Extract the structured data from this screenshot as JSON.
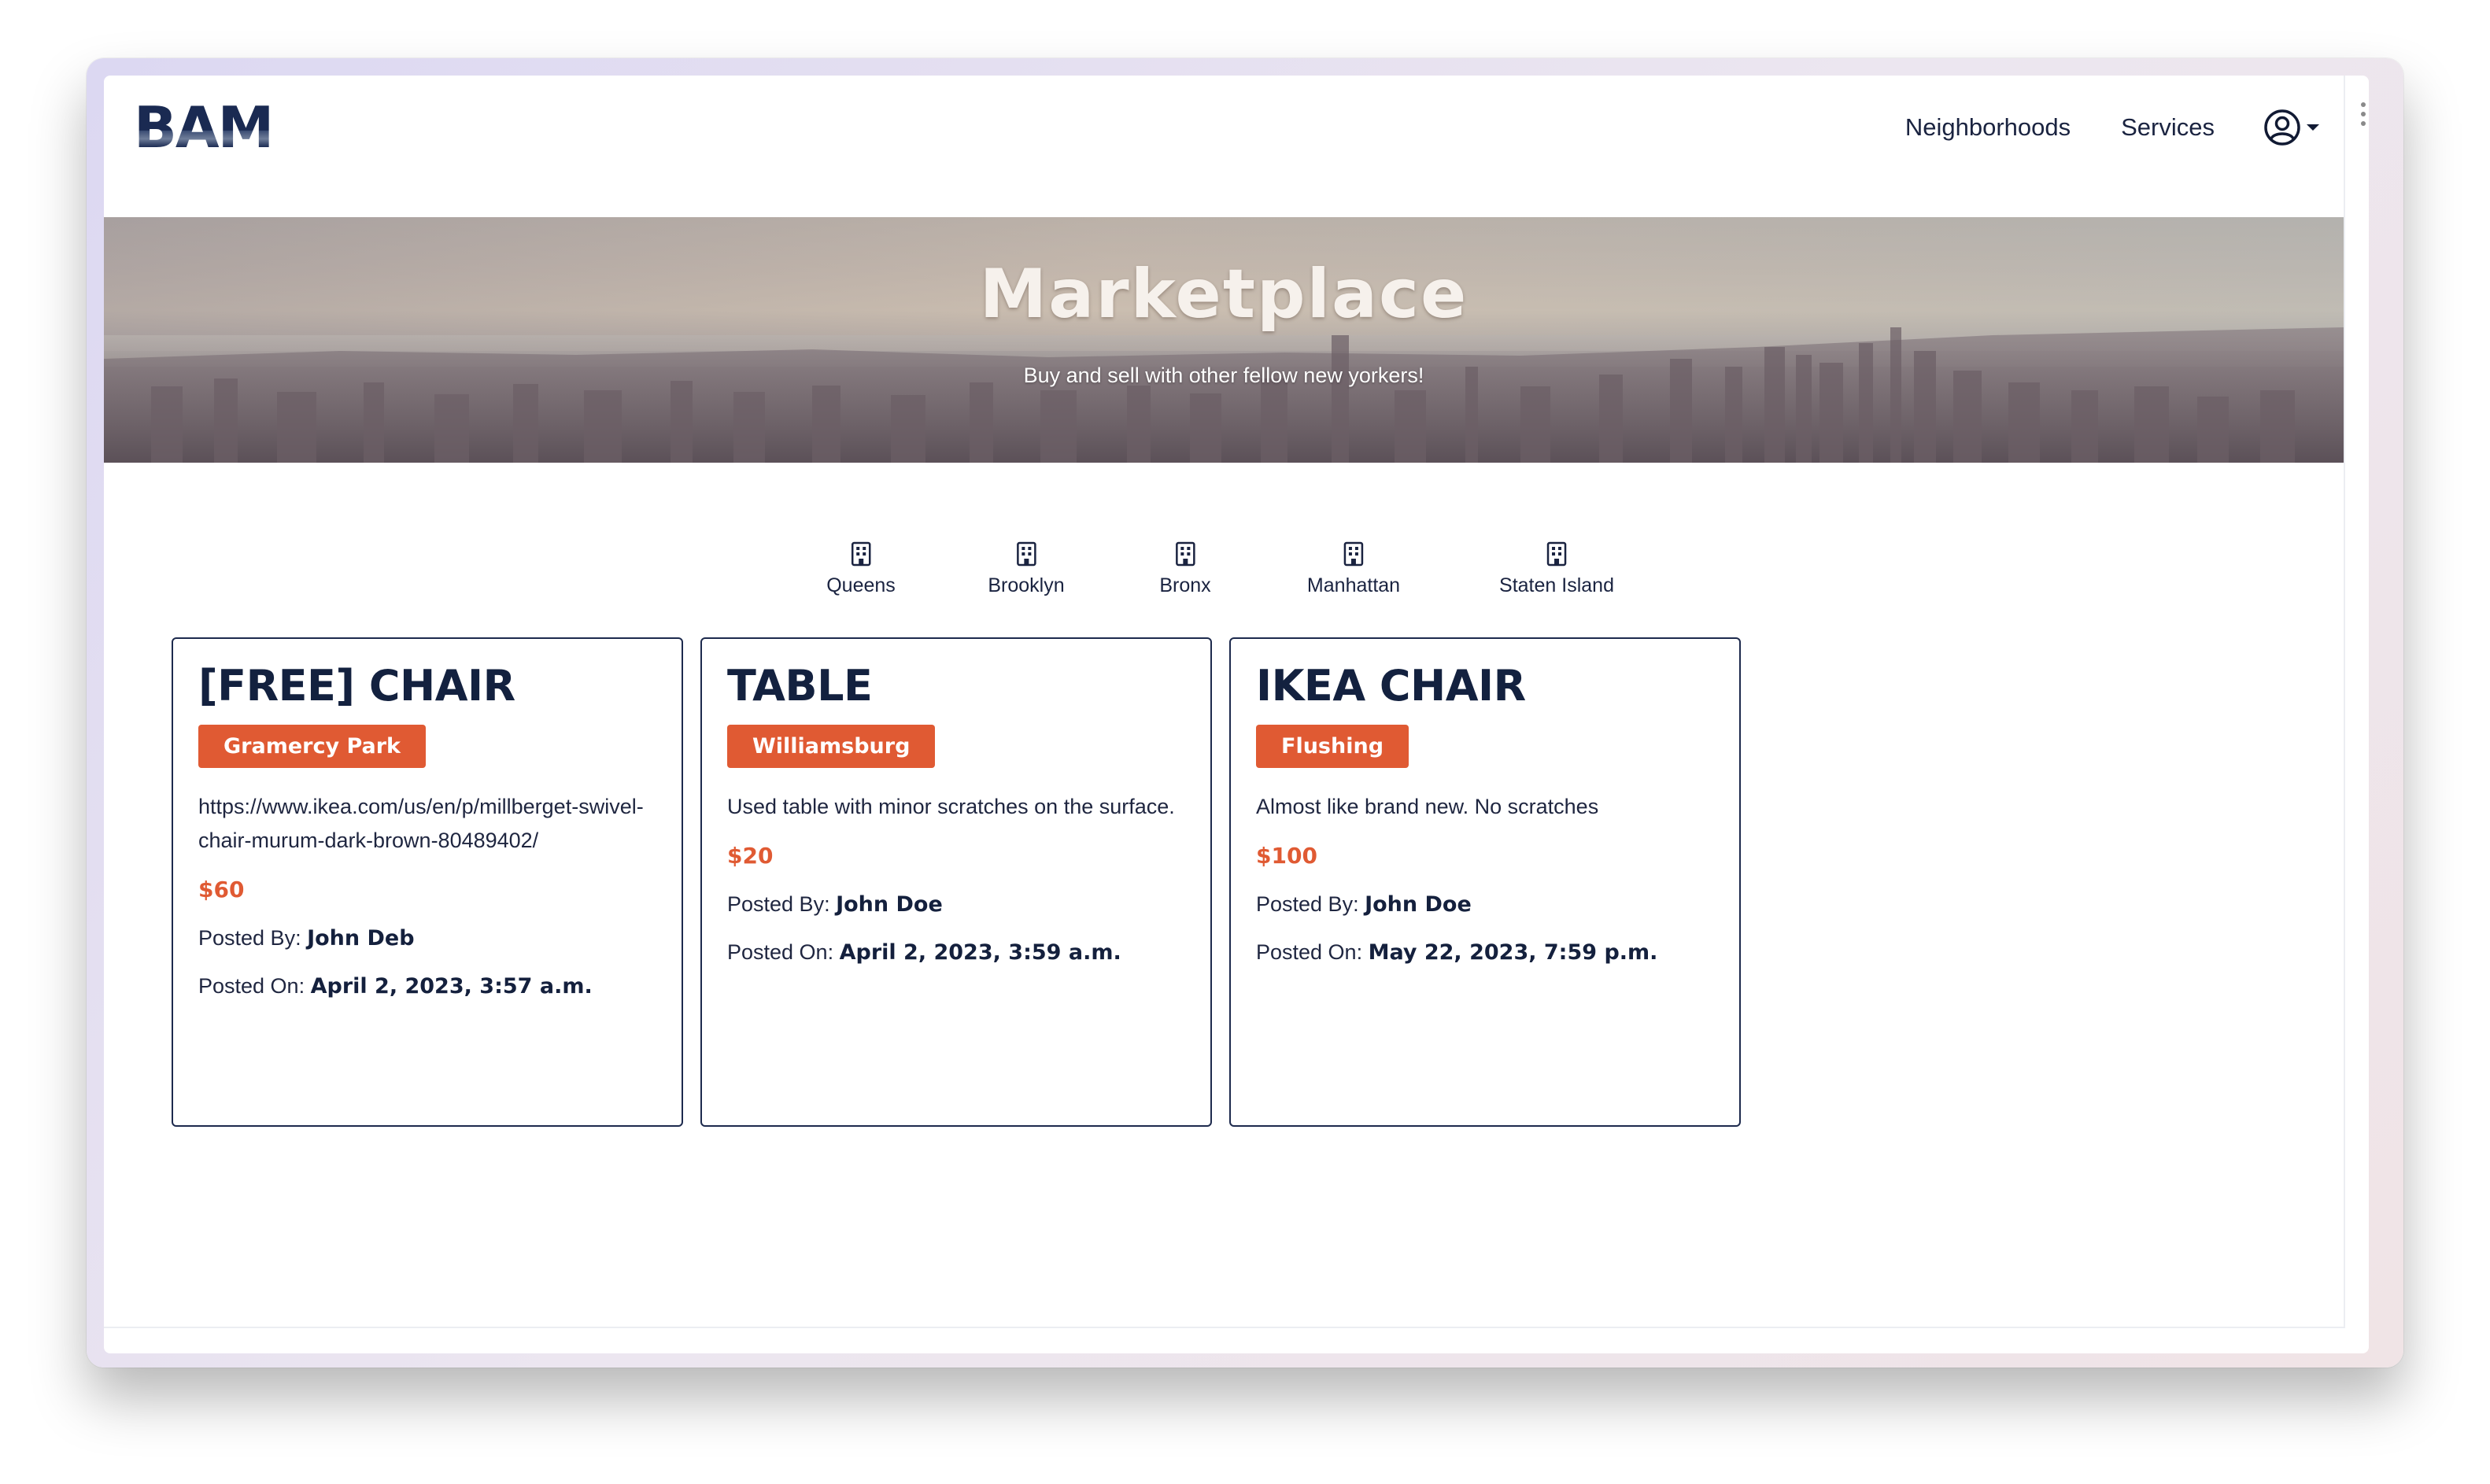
{
  "navbar": {
    "logo": "BAM",
    "links": [
      "Neighborhoods",
      "Services"
    ],
    "profile_icon": "user-circle-icon"
  },
  "hero": {
    "title": "Marketplace",
    "subtitle": "Buy and sell with other fellow new yorkers!"
  },
  "boroughs": [
    {
      "label": "Queens",
      "icon": "building-icon"
    },
    {
      "label": "Brooklyn",
      "icon": "building-icon"
    },
    {
      "label": "Bronx",
      "icon": "building-icon"
    },
    {
      "label": "Manhattan",
      "icon": "building-icon"
    },
    {
      "label": "Staten Island",
      "icon": "building-icon"
    }
  ],
  "listings": [
    {
      "title": "[FREE] CHAIR",
      "neighborhood": "Gramercy Park",
      "description": "https://www.ikea.com/us/en/p/millberget-swivel-chair-murum-dark-brown-80489402/",
      "price": "$60",
      "posted_by_label": "Posted By: ",
      "posted_by": "John Deb",
      "posted_on_label": "Posted On: ",
      "posted_on": "April 2, 2023, 3:57 a.m."
    },
    {
      "title": "TABLE",
      "neighborhood": "Williamsburg",
      "description": "Used table with minor scratches on the surface.",
      "price": "$20",
      "posted_by_label": "Posted By: ",
      "posted_by": "John Doe",
      "posted_on_label": "Posted On: ",
      "posted_on": "April 2, 2023, 3:59 a.m."
    },
    {
      "title": "IKEA CHAIR",
      "neighborhood": "Flushing",
      "description": "Almost like brand new. No scratches",
      "price": "$100",
      "posted_by_label": "Posted By: ",
      "posted_by": "John Doe",
      "posted_on_label": "Posted On: ",
      "posted_on": "May 22, 2023, 7:59 p.m."
    }
  ],
  "colors": {
    "accent": "#e05a33",
    "navy": "#13213f"
  }
}
